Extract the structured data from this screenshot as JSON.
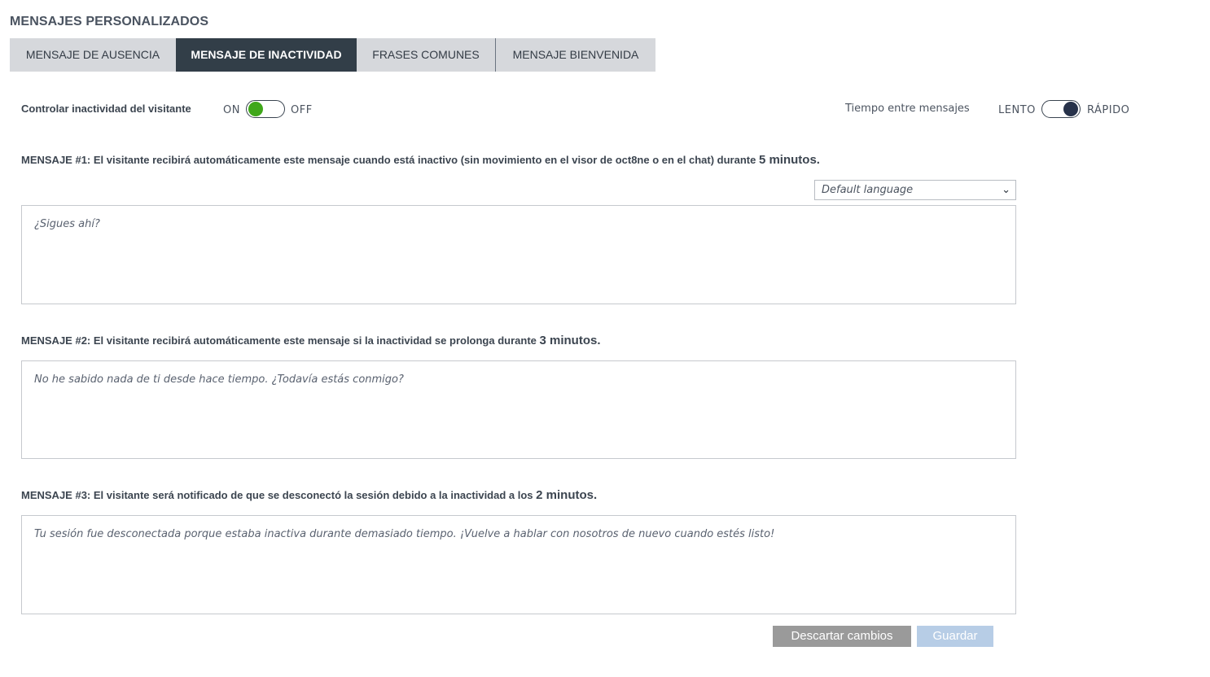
{
  "page": {
    "title": "MENSAJES PERSONALIZADOS"
  },
  "tabs": [
    {
      "label": "MENSAJE DE AUSENCIA",
      "active": false
    },
    {
      "label": "MENSAJE DE INACTIVIDAD",
      "active": true
    },
    {
      "label": "FRASES COMUNES",
      "active": false
    },
    {
      "label": "MENSAJE BIENVENIDA",
      "active": false
    }
  ],
  "controls": {
    "inactivity_label": "Controlar inactividad del visitante",
    "inactivity_on": "ON",
    "inactivity_off": "OFF",
    "inactivity_state": "ON",
    "time_label": "Tiempo entre mensajes",
    "slow_label": "LENTO",
    "fast_label": "RÁPIDO",
    "speed_state": "RÁPIDO"
  },
  "language_select": {
    "value": "Default language"
  },
  "messages": [
    {
      "prefix": "MENSAJE #1:",
      "text": " El visitante recibirá automáticamente este mensaje cuando está inactivo (sin movimiento en el visor de oct8ne o en el chat) durante ",
      "duration": "5 minutos.",
      "placeholder": "¿Sigues ahí?"
    },
    {
      "prefix": "MENSAJE #2:",
      "text": " El visitante recibirá automáticamente este mensaje si la inactividad se prolonga durante ",
      "duration": "3 minutos.",
      "placeholder": "No he sabido nada de ti desde hace tiempo. ¿Todavía estás conmigo?"
    },
    {
      "prefix": "MENSAJE #3:",
      "text": " El visitante será notificado de que se desconectó la sesión debido a la inactividad a los ",
      "duration": "2 minutos.",
      "placeholder": "Tu sesión fue desconectada porque estaba inactiva durante demasiado tiempo. ¡Vuelve a hablar con nosotros de nuevo cuando estés listo!"
    }
  ],
  "buttons": {
    "discard": "Descartar cambios",
    "save": "Guardar"
  },
  "colors": {
    "tab_active_bg": "#323e48",
    "tab_bg": "#d6d8dc",
    "toggle_on": "#3fa71a",
    "toggle_speed_knob": "#27324a",
    "discard_bg": "#9a9a9a",
    "save_bg": "#b7cde6"
  }
}
